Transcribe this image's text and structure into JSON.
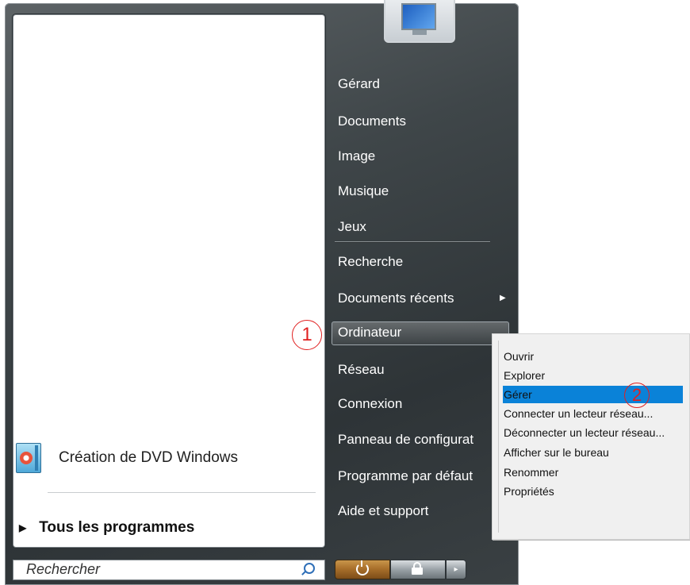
{
  "left_pane": {
    "pinned_items": [
      {
        "label": "Création de DVD Windows",
        "icon": "dvd-maker-icon"
      }
    ],
    "all_programs_label": "Tous les programmes"
  },
  "search": {
    "placeholder": "Rechercher"
  },
  "right_pane": {
    "items": [
      {
        "label": "Gérard"
      },
      {
        "label": "Documents"
      },
      {
        "label": "Image"
      },
      {
        "label": "Musique"
      },
      {
        "label": "Jeux"
      },
      {
        "label": "Recherche"
      },
      {
        "label": "Documents récents"
      },
      {
        "label": "Ordinateur"
      },
      {
        "label": "Réseau"
      },
      {
        "label": "Connexion"
      },
      {
        "label": "Panneau de configurat"
      },
      {
        "label": "Programme par défaut"
      },
      {
        "label": "Aide et support"
      }
    ]
  },
  "annotations": {
    "marker1": "1",
    "marker2": "2"
  },
  "context_menu": {
    "items": [
      {
        "label": "Ouvrir"
      },
      {
        "label": "Explorer"
      },
      {
        "label": "Gérer"
      },
      {
        "label": "Connecter un lecteur réseau..."
      },
      {
        "label": "Déconnecter un lecteur réseau..."
      },
      {
        "label": "Afficher sur le bureau"
      },
      {
        "label": "Renommer"
      },
      {
        "label": "Propriétés"
      }
    ],
    "selected_color": "#0a82d8"
  },
  "bottom_buttons": {
    "power_icon": "power-icon",
    "lock_icon": "lock-icon",
    "more_icon": "arrow-right-icon",
    "more_glyph": "▸"
  }
}
